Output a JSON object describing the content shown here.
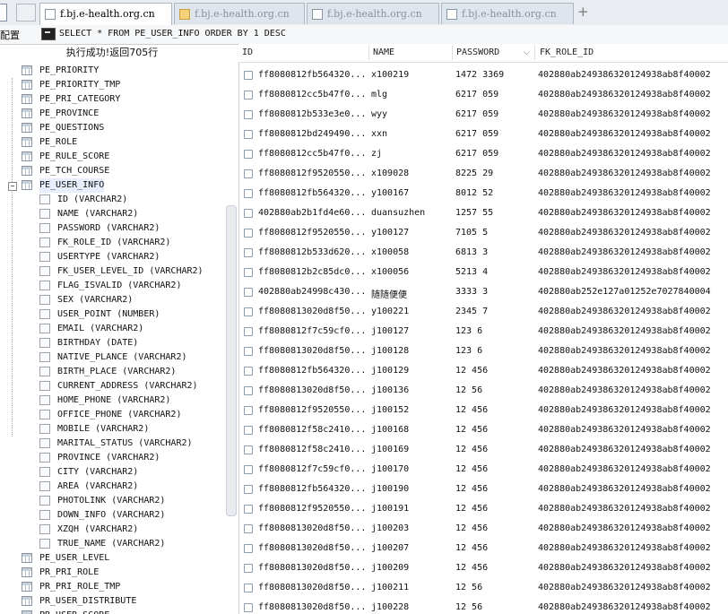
{
  "tabs": [
    {
      "label": "f.bj.e-health.org.cn",
      "active": true,
      "icon": "page-icon"
    },
    {
      "label": "f.bj.e-health.org.cn",
      "active": false,
      "icon": "folder-icon"
    },
    {
      "label": "f.bj.e-health.org.cn",
      "active": false,
      "icon": "page-icon"
    },
    {
      "label": "f.bj.e-health.org.cn",
      "active": false,
      "icon": "page-icon"
    }
  ],
  "new_tab": "+",
  "toolbar": {
    "config_label": "配置",
    "sql": "SELECT * FROM PE_USER_INFO ORDER BY 1 DESC"
  },
  "status": "执行成功!返回705行",
  "tree": {
    "tables_before": [
      "PE_PRIORITY",
      "PE_PRIORITY_TMP",
      "PE_PRI_CATEGORY",
      "PE_PROVINCE",
      "PE_QUESTIONS",
      "PE_ROLE",
      "PE_RULE_SCORE",
      "PE_TCH_COURSE"
    ],
    "expanded": "PE_USER_INFO",
    "expander": "−",
    "columns": [
      "ID (VARCHAR2)",
      "NAME (VARCHAR2)",
      "PASSWORD (VARCHAR2)",
      "FK_ROLE_ID (VARCHAR2)",
      "USERTYPE (VARCHAR2)",
      "FK_USER_LEVEL_ID (VARCHAR2)",
      "FLAG_ISVALID (VARCHAR2)",
      "SEX (VARCHAR2)",
      "USER_POINT (NUMBER)",
      "EMAIL (VARCHAR2)",
      "BIRTHDAY (DATE)",
      "NATIVE_PLANCE (VARCHAR2)",
      "BIRTH_PLACE (VARCHAR2)",
      "CURRENT_ADDRESS (VARCHAR2)",
      "HOME_PHONE (VARCHAR2)",
      "OFFICE_PHONE (VARCHAR2)",
      "MOBILE (VARCHAR2)",
      "MARITAL_STATUS (VARCHAR2)",
      "PROVINCE (VARCHAR2)",
      "CITY (VARCHAR2)",
      "AREA (VARCHAR2)",
      "PHOTOLINK (VARCHAR2)",
      "DOWN_INFO (VARCHAR2)",
      "XZQH (VARCHAR2)",
      "TRUE_NAME (VARCHAR2)"
    ],
    "tables_after": [
      "PE_USER_LEVEL",
      "PR_PRI_ROLE",
      "PR_PRI_ROLE_TMP",
      "PR_USER_DISTRIBUTE",
      "PR_USER_SCORE"
    ]
  },
  "grid": {
    "headers": {
      "id": "ID",
      "name": "NAME",
      "password": "PASSWORD",
      "fk": "FK_ROLE_ID"
    },
    "rows": [
      {
        "id": "ff8080812fb564320...",
        "name": "x100219",
        "password": "1472 3369",
        "fk": "402880ab249386320124938ab8f40002"
      },
      {
        "id": "ff8080812cc5b47f0...",
        "name": "mlg",
        "password": "6217 059",
        "fk": "402880ab249386320124938ab8f40002"
      },
      {
        "id": "ff8080812b533e3e0...",
        "name": "wyy",
        "password": "6217 059",
        "fk": "402880ab249386320124938ab8f40002"
      },
      {
        "id": "ff8080812bd249490...",
        "name": "xxn",
        "password": "6217 059",
        "fk": "402880ab249386320124938ab8f40002"
      },
      {
        "id": "ff8080812cc5b47f0...",
        "name": "zj",
        "password": "6217 059",
        "fk": "402880ab249386320124938ab8f40002"
      },
      {
        "id": "ff8080812f9520550...",
        "name": "x109028",
        "password": "8225 29",
        "fk": "402880ab249386320124938ab8f40002"
      },
      {
        "id": "ff8080812fb564320...",
        "name": "y100167",
        "password": "8012 52",
        "fk": "402880ab249386320124938ab8f40002"
      },
      {
        "id": "402880ab2b1fd4e60...",
        "name": "duansuzhen",
        "password": "1257 55",
        "fk": "402880ab249386320124938ab8f40002"
      },
      {
        "id": "ff8080812f9520550...",
        "name": "y100127",
        "password": "7105 5",
        "fk": "402880ab249386320124938ab8f40002"
      },
      {
        "id": "ff8080812b533d620...",
        "name": "x100058",
        "password": "6813 3",
        "fk": "402880ab249386320124938ab8f40002"
      },
      {
        "id": "ff8080812b2c85dc0...",
        "name": "x100056",
        "password": "5213 4",
        "fk": "402880ab249386320124938ab8f40002"
      },
      {
        "id": "402880ab24998c430...",
        "name": "随随便便",
        "password": "3333 3",
        "fk": "402880ab252e127a01252e7027840004"
      },
      {
        "id": "ff8080813020d8f50...",
        "name": "y100221",
        "password": "2345 7",
        "fk": "402880ab249386320124938ab8f40002"
      },
      {
        "id": "ff8080812f7c59cf0...",
        "name": "j100127",
        "password": "123 6",
        "fk": "402880ab249386320124938ab8f40002"
      },
      {
        "id": "ff8080813020d8f50...",
        "name": "j100128",
        "password": "123 6",
        "fk": "402880ab249386320124938ab8f40002"
      },
      {
        "id": "ff8080812fb564320...",
        "name": "j100129",
        "password": "12 456",
        "fk": "402880ab249386320124938ab8f40002"
      },
      {
        "id": "ff8080813020d8f50...",
        "name": "j100136",
        "password": "12 56",
        "fk": "402880ab249386320124938ab8f40002"
      },
      {
        "id": "ff8080812f9520550...",
        "name": "j100152",
        "password": "12 456",
        "fk": "402880ab249386320124938ab8f40002"
      },
      {
        "id": "ff8080812f58c2410...",
        "name": "j100168",
        "password": "12 456",
        "fk": "402880ab249386320124938ab8f40002"
      },
      {
        "id": "ff8080812f58c2410...",
        "name": "j100169",
        "password": "12 456",
        "fk": "402880ab249386320124938ab8f40002"
      },
      {
        "id": "ff8080812f7c59cf0...",
        "name": "j100170",
        "password": "12 456",
        "fk": "402880ab249386320124938ab8f40002"
      },
      {
        "id": "ff8080812fb564320...",
        "name": "j100190",
        "password": "12 456",
        "fk": "402880ab249386320124938ab8f40002"
      },
      {
        "id": "ff8080812f9520550...",
        "name": "j100191",
        "password": "12 456",
        "fk": "402880ab249386320124938ab8f40002"
      },
      {
        "id": "ff8080813020d8f50...",
        "name": "j100203",
        "password": "12 456",
        "fk": "402880ab249386320124938ab8f40002"
      },
      {
        "id": "ff8080813020d8f50...",
        "name": "j100207",
        "password": "12 456",
        "fk": "402880ab249386320124938ab8f40002"
      },
      {
        "id": "ff8080813020d8f50...",
        "name": "j100209",
        "password": "12 456",
        "fk": "402880ab249386320124938ab8f40002"
      },
      {
        "id": "ff8080813020d8f50...",
        "name": "j100211",
        "password": "12 56",
        "fk": "402880ab249386320124938ab8f40002"
      },
      {
        "id": "ff8080813020d8f50...",
        "name": "j100228",
        "password": "12 56",
        "fk": "402880ab249386320124938ab8f40002"
      }
    ]
  }
}
